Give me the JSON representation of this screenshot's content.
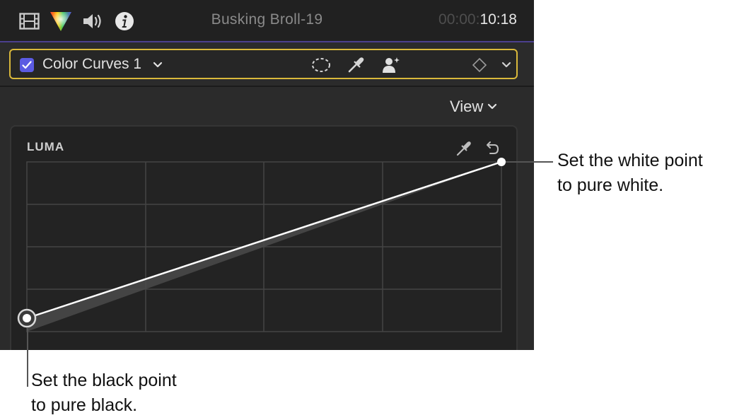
{
  "header": {
    "icons": [
      "film-strip-icon",
      "color-wheel-icon",
      "speaker-icon",
      "info-icon"
    ],
    "clip_name": "Busking Broll-19",
    "timecode_dim": "00:00:",
    "timecode_main": "10:18"
  },
  "effect": {
    "enabled": true,
    "name": "Color Curves 1",
    "icons": [
      "mask-shape-icon",
      "eyedropper-icon",
      "person-mask-icon",
      "keyframe-diamond-icon",
      "chevron-down-icon"
    ]
  },
  "view_menu": {
    "label": "View"
  },
  "curve": {
    "label": "LUMA",
    "icons": [
      "eyedropper-icon",
      "reset-arrow-icon"
    ],
    "black_point": {
      "input": 0.0,
      "output": 0.0
    },
    "white_point": {
      "input": 1.0,
      "output": 1.0
    }
  },
  "callouts": {
    "white_point": {
      "line1": "Set the white point",
      "line2": "to pure white."
    },
    "black_point": {
      "line1": "Set the black point",
      "line2": "to pure black."
    }
  }
}
